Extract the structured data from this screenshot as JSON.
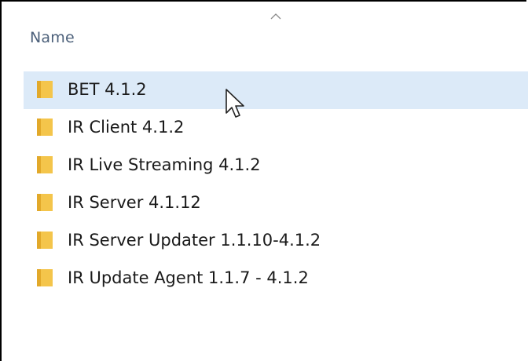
{
  "header": {
    "column_name": "Name",
    "sort_indicator": "chevron-up-icon"
  },
  "files": [
    {
      "name": "BET 4.1.2",
      "type": "folder",
      "selected": true
    },
    {
      "name": "IR Client 4.1.2",
      "type": "folder",
      "selected": false
    },
    {
      "name": "IR Live Streaming 4.1.2",
      "type": "folder",
      "selected": false
    },
    {
      "name": "IR Server 4.1.12",
      "type": "folder",
      "selected": false
    },
    {
      "name": "IR Server Updater 1.1.10-4.1.2",
      "type": "folder",
      "selected": false
    },
    {
      "name": "IR Update Agent 1.1.7 - 4.1.2",
      "type": "folder",
      "selected": false
    }
  ],
  "colors": {
    "selection": "#dceaf8",
    "folder": "#f4c54b",
    "header_text": "#4c607a"
  },
  "icons": {
    "folder": "folder-icon",
    "cursor": "mouse-pointer-icon"
  }
}
